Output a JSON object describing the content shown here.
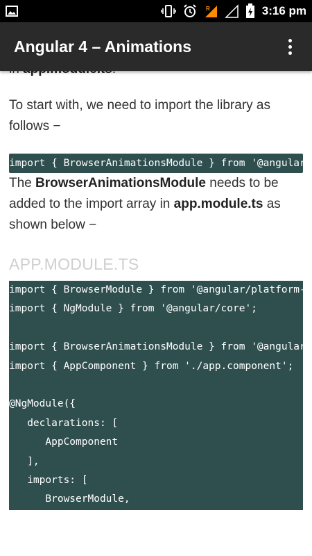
{
  "status_bar": {
    "time": "3:16 pm",
    "icons": [
      "image-icon",
      "vibrate-icon",
      "alarm-icon",
      "signal-roaming-icon",
      "signal-empty-icon",
      "battery-charging-icon"
    ]
  },
  "app_bar": {
    "title": "Angular 4 – Animations",
    "menu_icon": "more-vert-icon"
  },
  "article": {
    "partial_line_prefix": "in ",
    "partial_line_bold": "app.module.ts",
    "partial_line_suffix": ".",
    "para_import_intro": "To start with, we need to import the library as follows −",
    "inline_code": "import { BrowserAnimationsModule } from '@angular/platform-browser/animations';",
    "para2_bold1": "BrowserAnimationsModule",
    "para2_text1": "The ",
    "para2_text2": " needs to be added to the import array in ",
    "para2_bold2": "app.module.ts",
    "para2_text3": " as shown below −",
    "section_heading": "APP.MODULE.TS",
    "code_lines": [
      "import { BrowserModule } from '@angular/platform-browser';",
      "import { NgModule } from '@angular/core';",
      "",
      "import { BrowserAnimationsModule } from '@angular/platform-browser/animations';",
      "import { AppComponent } from './app.component';",
      "",
      "@NgModule({",
      "   declarations: [",
      "      AppComponent",
      "   ],",
      "   imports: [",
      "      BrowserModule,"
    ]
  },
  "colors": {
    "code_background": "#2f4f4f",
    "app_bar": "#2a2a2a",
    "heading": "#cfcfcf"
  }
}
